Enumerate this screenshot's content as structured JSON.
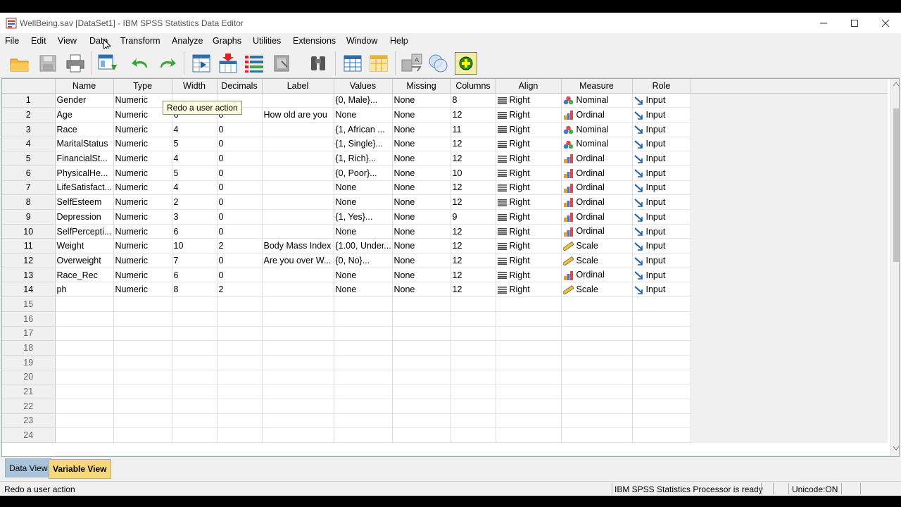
{
  "window": {
    "title": "WellBeing.sav [DataSet1] - IBM SPSS Statistics Data Editor",
    "minimize_icon": "minimize-icon",
    "maximize_icon": "maximize-icon",
    "close_icon": "close-icon"
  },
  "menu": [
    "File",
    "Edit",
    "View",
    "Data",
    "Transform",
    "Analyze",
    "Graphs",
    "Utilities",
    "Extensions",
    "Window",
    "Help"
  ],
  "toolbar": {
    "buttons": [
      "open-icon",
      "save-icon",
      "print-icon",
      "recall-dialog-icon",
      "undo-icon",
      "redo-icon",
      "goto-case-icon",
      "goto-variable-icon",
      "variables-icon",
      "run-descriptives-icon",
      "find-icon",
      "insert-cases-icon",
      "insert-variable-icon",
      "split-file-icon",
      "weight-cases-icon",
      "use-sets-icon",
      "spelling-icon"
    ]
  },
  "tooltip": "Redo a user action",
  "grid": {
    "columns": [
      "Name",
      "Type",
      "Width",
      "Decimals",
      "Label",
      "Values",
      "Missing",
      "Columns",
      "Align",
      "Measure",
      "Role"
    ],
    "rows": [
      {
        "n": "1",
        "name": "Gender",
        "type": "Numeric",
        "width": "",
        "decimals": "",
        "label": "",
        "values": "{0, Male}...",
        "missing": "None",
        "columns": "8",
        "align": "Right",
        "measure": "Nominal",
        "role": "Input"
      },
      {
        "n": "2",
        "name": "Age",
        "type": "Numeric",
        "width": "6",
        "decimals": "0",
        "label": "How old are you",
        "values": "None",
        "missing": "None",
        "columns": "12",
        "align": "Right",
        "measure": "Ordinal",
        "role": "Input"
      },
      {
        "n": "3",
        "name": "Race",
        "type": "Numeric",
        "width": "4",
        "decimals": "0",
        "label": "",
        "values": "{1, African ...",
        "missing": "None",
        "columns": "11",
        "align": "Right",
        "measure": "Nominal",
        "role": "Input"
      },
      {
        "n": "4",
        "name": "MaritalStatus",
        "type": "Numeric",
        "width": "5",
        "decimals": "0",
        "label": "",
        "values": "{1, Single}...",
        "missing": "None",
        "columns": "12",
        "align": "Right",
        "measure": "Nominal",
        "role": "Input"
      },
      {
        "n": "5",
        "name": "FinancialSt...",
        "type": "Numeric",
        "width": "4",
        "decimals": "0",
        "label": "",
        "values": "{1, Rich}...",
        "missing": "None",
        "columns": "12",
        "align": "Right",
        "measure": "Ordinal",
        "role": "Input"
      },
      {
        "n": "6",
        "name": "PhysicalHe...",
        "type": "Numeric",
        "width": "5",
        "decimals": "0",
        "label": "",
        "values": "{0, Poor}...",
        "missing": "None",
        "columns": "10",
        "align": "Right",
        "measure": "Ordinal",
        "role": "Input"
      },
      {
        "n": "7",
        "name": "LifeSatisfact...",
        "type": "Numeric",
        "width": "4",
        "decimals": "0",
        "label": "",
        "values": "None",
        "missing": "None",
        "columns": "12",
        "align": "Right",
        "measure": "Ordinal",
        "role": "Input"
      },
      {
        "n": "8",
        "name": "SelfEsteem",
        "type": "Numeric",
        "width": "2",
        "decimals": "0",
        "label": "",
        "values": "None",
        "missing": "None",
        "columns": "12",
        "align": "Right",
        "measure": "Ordinal",
        "role": "Input"
      },
      {
        "n": "9",
        "name": "Depression",
        "type": "Numeric",
        "width": "3",
        "decimals": "0",
        "label": "",
        "values": "{1, Yes}...",
        "missing": "None",
        "columns": "9",
        "align": "Right",
        "measure": "Ordinal",
        "role": "Input"
      },
      {
        "n": "10",
        "name": "SelfPercepti...",
        "type": "Numeric",
        "width": "6",
        "decimals": "0",
        "label": "",
        "values": "None",
        "missing": "None",
        "columns": "12",
        "align": "Right",
        "measure": "Ordinal",
        "role": "Input"
      },
      {
        "n": "11",
        "name": "Weight",
        "type": "Numeric",
        "width": "10",
        "decimals": "2",
        "label": "Body Mass Index",
        "values": "{1.00, Under...",
        "missing": "None",
        "columns": "12",
        "align": "Right",
        "measure": "Scale",
        "role": "Input"
      },
      {
        "n": "12",
        "name": "Overweight",
        "type": "Numeric",
        "width": "7",
        "decimals": "0",
        "label": "Are you over W...",
        "values": "{0, No}...",
        "missing": "None",
        "columns": "12",
        "align": "Right",
        "measure": "Scale",
        "role": "Input"
      },
      {
        "n": "13",
        "name": "Race_Rec",
        "type": "Numeric",
        "width": "6",
        "decimals": "0",
        "label": "",
        "values": "None",
        "missing": "None",
        "columns": "12",
        "align": "Right",
        "measure": "Ordinal",
        "role": "Input"
      },
      {
        "n": "14",
        "name": "ph",
        "type": "Numeric",
        "width": "8",
        "decimals": "2",
        "label": "",
        "values": "None",
        "missing": "None",
        "columns": "12",
        "align": "Right",
        "measure": "Scale",
        "role": "Input"
      }
    ],
    "empty_rows": [
      "15",
      "16",
      "17",
      "18",
      "19",
      "20",
      "21",
      "22",
      "23",
      "24"
    ]
  },
  "tabs": [
    "Data View",
    "Variable View"
  ],
  "active_tab": "Variable View",
  "status": {
    "left": "Redo a user action",
    "processor": "IBM SPSS Statistics Processor is ready",
    "unicode": "Unicode:ON"
  },
  "colors": {
    "active_tab": "#f6d77a",
    "inactive_tab": "#a8c4dc",
    "tooltip_bg": "#ffffe1"
  }
}
